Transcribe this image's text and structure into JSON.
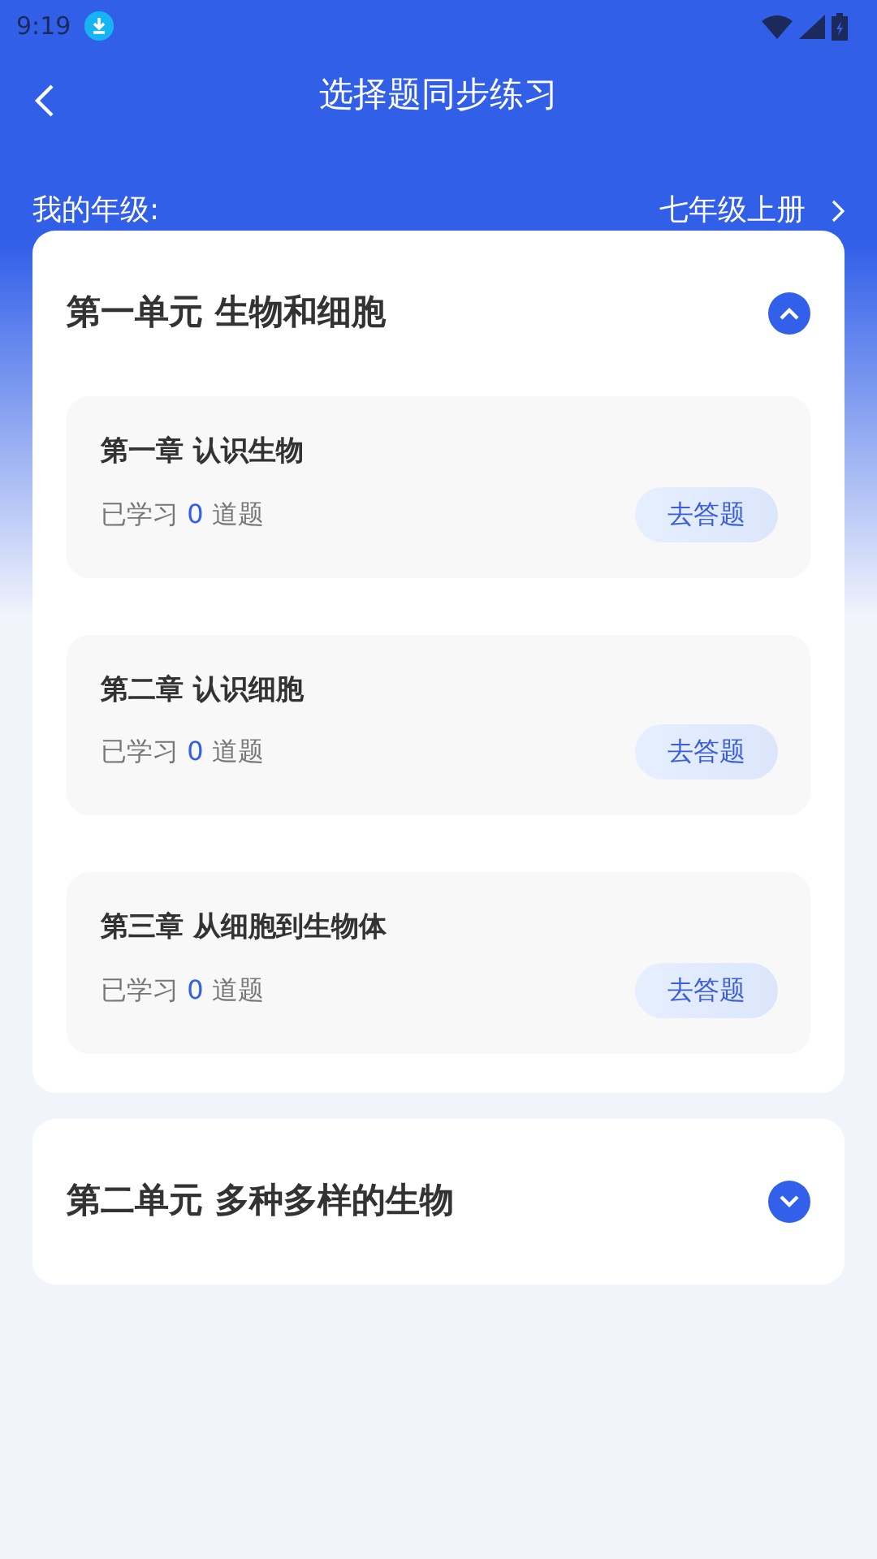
{
  "status_bar": {
    "time": "9:19"
  },
  "header": {
    "title": "选择题同步练习"
  },
  "grade": {
    "label": "我的年级:",
    "value": "七年级上册"
  },
  "units": [
    {
      "title": "第一单元 生物和细胞",
      "expanded": true,
      "chapters": [
        {
          "title": "第一章 认识生物",
          "prefix": "已学习",
          "count": "0",
          "suffix": "道题",
          "button": "去答题"
        },
        {
          "title": "第二章 认识细胞",
          "prefix": "已学习",
          "count": "0",
          "suffix": "道题",
          "button": "去答题"
        },
        {
          "title": "第三章 从细胞到生物体",
          "prefix": "已学习",
          "count": "0",
          "suffix": "道题",
          "button": "去答题"
        }
      ]
    },
    {
      "title": "第二单元 多种多样的生物",
      "expanded": false
    }
  ]
}
